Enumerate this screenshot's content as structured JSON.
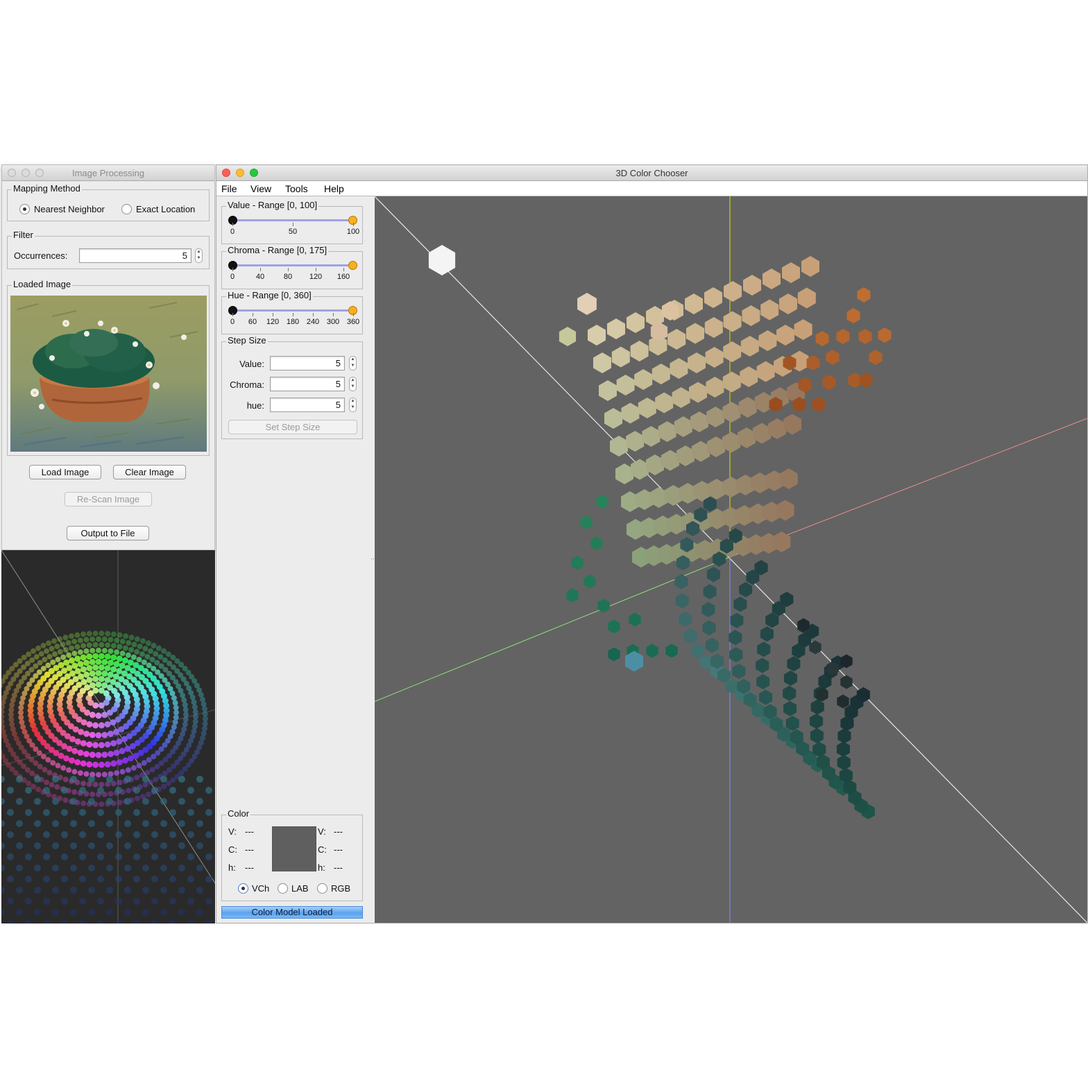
{
  "image_processing": {
    "title": "Image Processing",
    "mapping_method": {
      "label": "Mapping Method",
      "nearest_neighbor": "Nearest Neighbor",
      "exact_location": "Exact Location",
      "selected": "Nearest Neighbor"
    },
    "filter": {
      "label": "Filter",
      "occurrences_label": "Occurrences:",
      "occurrences_value": "5"
    },
    "loaded_image_label": "Loaded Image",
    "load_button": "Load Image",
    "clear_button": "Clear Image",
    "rescan_button": "Re-Scan Image",
    "output_button": "Output to File"
  },
  "chooser": {
    "title": "3D Color Chooser",
    "menu": [
      "File",
      "View",
      "Tools",
      "Help"
    ],
    "value_range": {
      "label": "Value - Range [0, 100]",
      "ticks": [
        "0",
        "50",
        "100"
      ],
      "low": 0,
      "high": 100
    },
    "chroma_range": {
      "label": "Chroma - Range [0, 175]",
      "ticks": [
        "0",
        "40",
        "80",
        "120",
        "160"
      ],
      "low": 0,
      "high": 175
    },
    "hue_range": {
      "label": "Hue - Range [0, 360]",
      "ticks": [
        "0",
        "60",
        "120",
        "180",
        "240",
        "300",
        "360"
      ],
      "low": 0,
      "high": 360
    },
    "step_size": {
      "label": "Step Size",
      "value_label": "Value:",
      "value": "5",
      "chroma_label": "Chroma:",
      "chroma": "5",
      "hue_label": "hue:",
      "hue": "5",
      "set_button": "Set Step Size"
    },
    "color": {
      "label": "Color",
      "left": {
        "v_label": "V:",
        "v": "---",
        "c_label": "C:",
        "c": "---",
        "h_label": "h:",
        "h": "---"
      },
      "right": {
        "v_label": "V:",
        "v": "---",
        "c_label": "C:",
        "c": "---",
        "h_label": "h:",
        "h": "---"
      },
      "swatch_color": "#5f5f5f",
      "models": [
        "VCh",
        "LAB",
        "RGB"
      ],
      "selected_model": "VCh"
    },
    "status": "Color Model Loaded"
  },
  "colors": {
    "viewport_bg": "#636363",
    "accent_orange": "#f7b021",
    "slider_track": "#9fa1e8",
    "status_blue": "#5aa3ee"
  }
}
